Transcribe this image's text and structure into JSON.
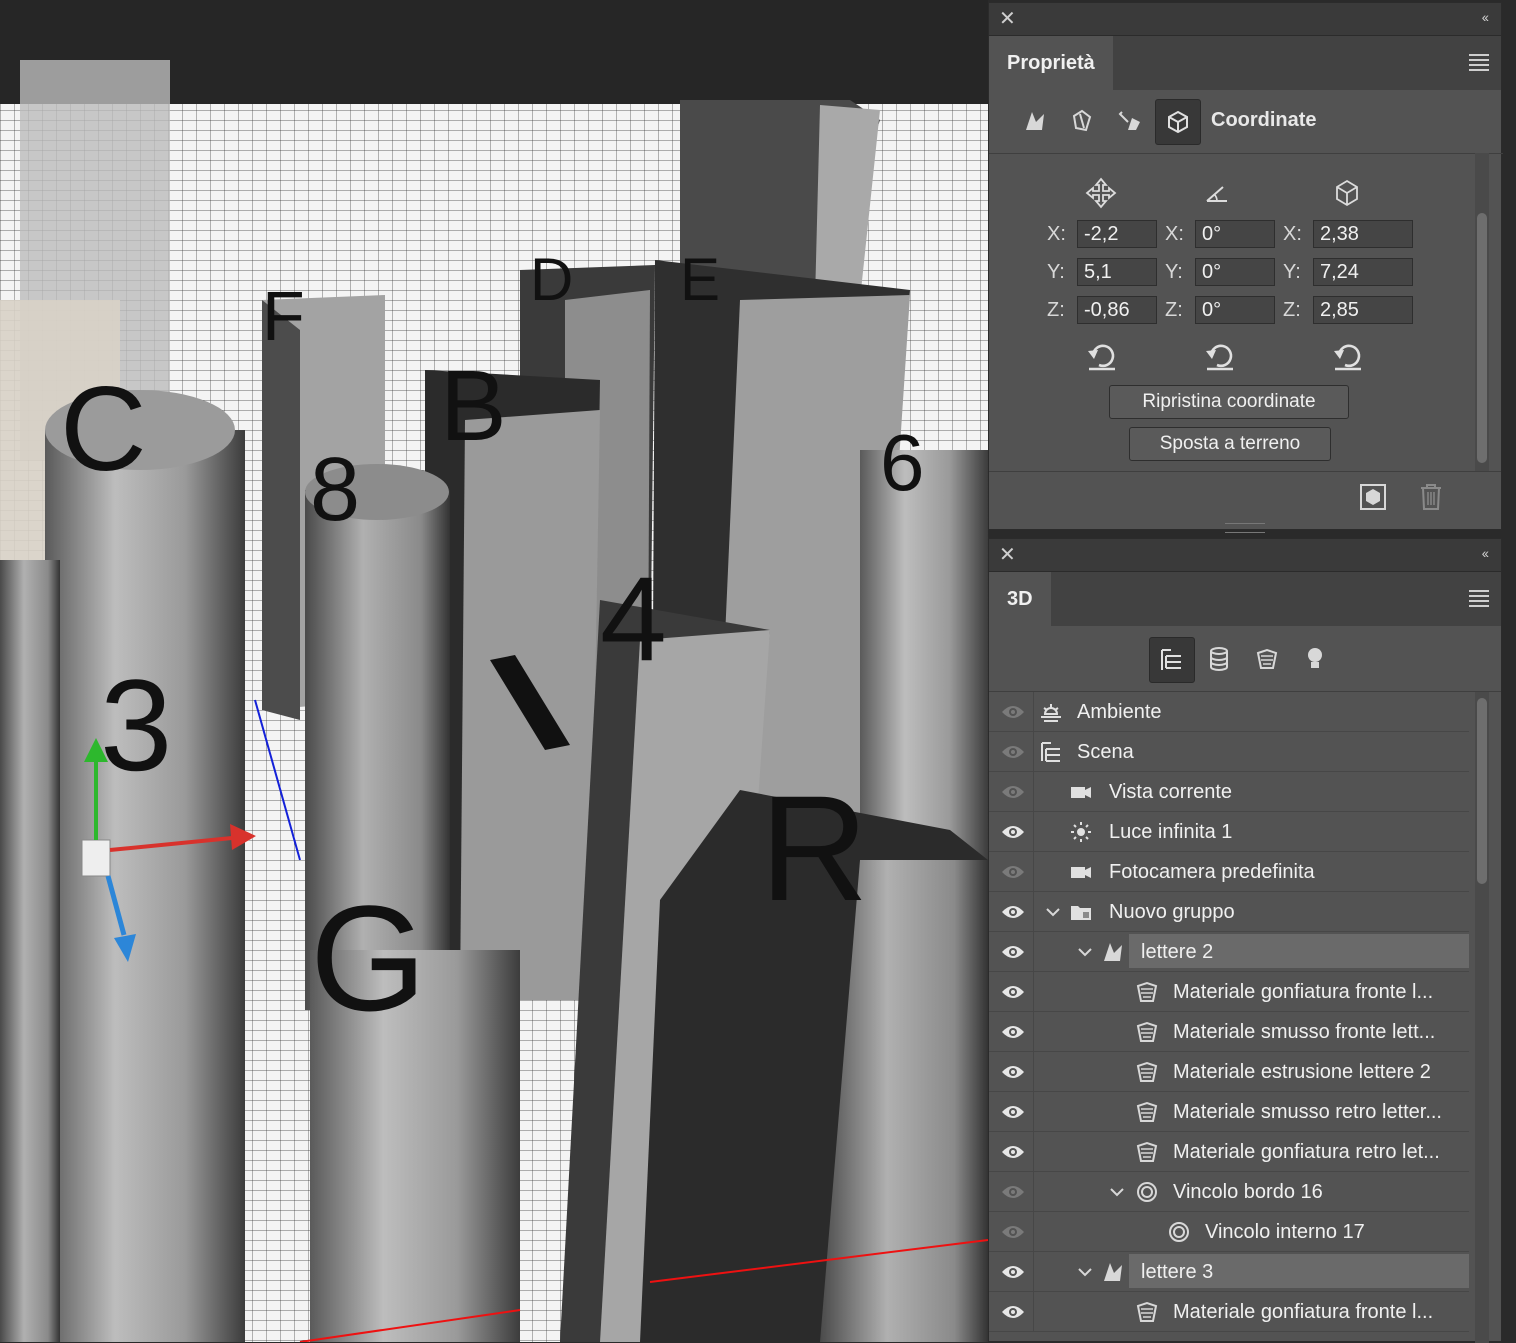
{
  "properties_panel": {
    "tab": "Proprietà",
    "section_title": "Coordinate",
    "rows": [
      {
        "axis_label": "X:",
        "position": "-2,2",
        "rotation": "0°",
        "scale": "2,38"
      },
      {
        "axis_label": "Y:",
        "position": "5,1",
        "rotation": "0°",
        "scale": "7,24"
      },
      {
        "axis_label": "Z:",
        "position": "-0,86",
        "rotation": "0°",
        "scale": "2,85"
      }
    ],
    "reset_coords_label": "Ripristina coordinate",
    "move_to_ground_label": "Sposta a terreno"
  },
  "three_d_panel": {
    "tab": "3D",
    "items": [
      {
        "label": "Ambiente",
        "icon": "environment-icon",
        "visible": "dim"
      },
      {
        "label": "Scena",
        "icon": "scene-icon",
        "visible": "dim"
      },
      {
        "label": "Vista corrente",
        "icon": "camera-icon",
        "visible": "dim"
      },
      {
        "label": "Luce infinita 1",
        "icon": "sun-icon",
        "visible": "on"
      },
      {
        "label": "Fotocamera predefinita",
        "icon": "camera-icon",
        "visible": "dim"
      },
      {
        "label": "Nuovo gruppo",
        "icon": "folder-icon",
        "visible": "on"
      },
      {
        "label": "lettere 2",
        "icon": "mesh-icon",
        "visible": "on"
      },
      {
        "label": "Materiale gonfiatura fronte l...",
        "icon": "material-icon",
        "visible": "on"
      },
      {
        "label": "Materiale smusso fronte lett...",
        "icon": "material-icon",
        "visible": "on"
      },
      {
        "label": "Materiale estrusione lettere 2",
        "icon": "material-icon",
        "visible": "on"
      },
      {
        "label": "Materiale smusso retro letter...",
        "icon": "material-icon",
        "visible": "on"
      },
      {
        "label": "Materiale gonfiatura retro let...",
        "icon": "material-icon",
        "visible": "on"
      },
      {
        "label": "Vincolo bordo 16",
        "icon": "constraint-icon",
        "visible": "dim"
      },
      {
        "label": "Vincolo interno 17",
        "icon": "constraint-icon",
        "visible": "dim"
      },
      {
        "label": "lettere 3",
        "icon": "mesh-icon",
        "visible": "on"
      },
      {
        "label": "Materiale gonfiatura fronte l...",
        "icon": "material-icon",
        "visible": "on"
      }
    ]
  },
  "viewport": {
    "letters": [
      "C",
      "F",
      "D",
      "E",
      "8",
      "B",
      "4",
      "3",
      "G",
      "R",
      "6"
    ]
  }
}
